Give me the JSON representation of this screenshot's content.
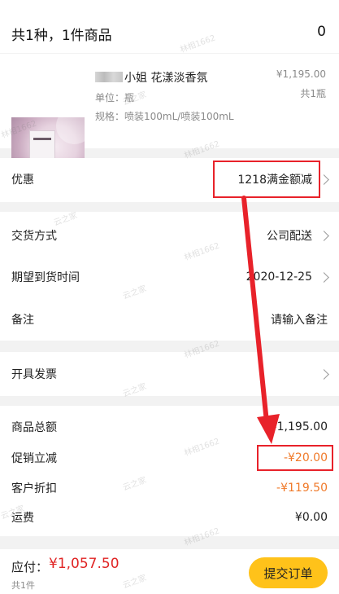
{
  "header": {
    "title": "共1种，1件商品",
    "count": "0"
  },
  "product": {
    "name": "小姐 花漾淡香氛",
    "unit": "单位：瓶",
    "spec": "规格：喷装100mL/喷装100mL",
    "price": "¥1,195.00",
    "qty": "共1瓶"
  },
  "discount": {
    "label": "优惠",
    "value": "1218满金额减"
  },
  "delivery": [
    {
      "label": "交货方式",
      "value": "公司配送"
    },
    {
      "label": "期望到货时间",
      "value": "2020-12-25"
    },
    {
      "label": "备注",
      "value": "请输入备注"
    }
  ],
  "invoice": {
    "label": "开具发票"
  },
  "summary": [
    {
      "label": "商品总额",
      "value": "¥1,195.00"
    },
    {
      "label": "促销立减",
      "value": "-¥20.00"
    },
    {
      "label": "客户折扣",
      "value": "-¥119.50"
    },
    {
      "label": "运费",
      "value": "¥0.00"
    }
  ],
  "footer": {
    "pay_label": "应付：",
    "pay_amount": "¥1,057.50",
    "pay_sub": "共1件",
    "submit": "提交订单"
  },
  "watermarks": [
    "林相1662",
    "云之家"
  ],
  "colors": {
    "accent": "#ffc21a",
    "red": "#e02424",
    "orange": "#f07a2a",
    "annotation": "#e8222a"
  }
}
